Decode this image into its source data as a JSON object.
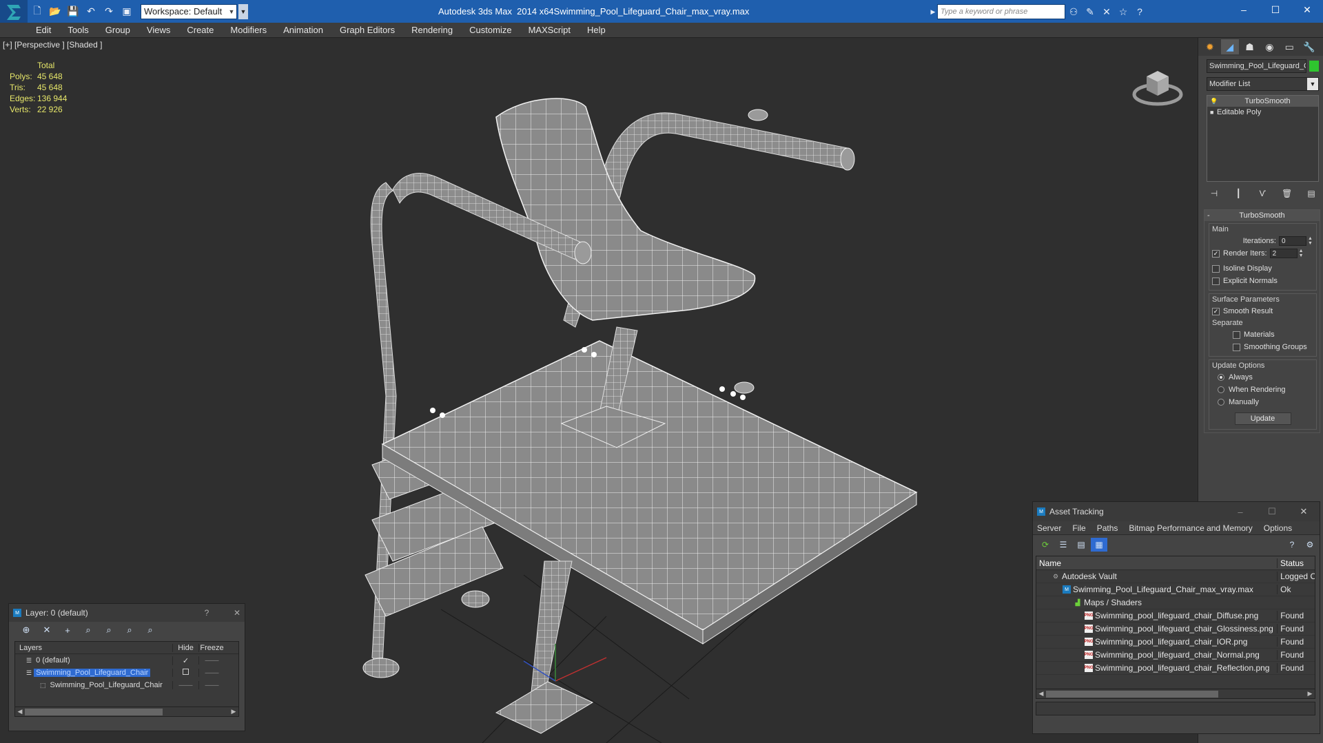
{
  "titlebar": {
    "app_title": "Autodesk 3ds Max  2014 x64",
    "file_title": "Swimming_Pool_Lifeguard_Chair_max_vray.max",
    "workspace_label": "Workspace: Default",
    "search_placeholder": "Type a keyword or phrase",
    "minimize": "–",
    "maximize": "☐",
    "close": "✕"
  },
  "menu": [
    "Edit",
    "Tools",
    "Group",
    "Views",
    "Create",
    "Modifiers",
    "Animation",
    "Graph Editors",
    "Rendering",
    "Customize",
    "MAXScript",
    "Help"
  ],
  "viewport": {
    "label": "[+] [Perspective ] [Shaded ]",
    "stats": {
      "header": "Total",
      "polys_label": "Polys:",
      "polys": "45 648",
      "tris_label": "Tris:",
      "tris": "45 648",
      "edges_label": "Edges:",
      "edges": "136 944",
      "verts_label": "Verts:",
      "verts": "22 926"
    }
  },
  "command_panel": {
    "object_name": "Swimming_Pool_Lifeguard_Ch",
    "object_color": "#2fc52f",
    "modifier_list": "Modifier List",
    "stack": [
      "TurboSmooth",
      "Editable Poly"
    ],
    "rollout_title": "TurboSmooth",
    "main_group": "Main",
    "iterations_label": "Iterations:",
    "iterations": "0",
    "render_iters_label": "Render Iters:",
    "render_iters": "2",
    "isoline_label": "Isoline Display",
    "explicit_normals_label": "Explicit Normals",
    "surface_group": "Surface Parameters",
    "smooth_result_label": "Smooth Result",
    "separate_label": "Separate",
    "materials_label": "Materials",
    "smoothing_groups_label": "Smoothing Groups",
    "update_group": "Update Options",
    "always_label": "Always",
    "when_rendering_label": "When Rendering",
    "manually_label": "Manually",
    "update_button": "Update"
  },
  "layer_dialog": {
    "title": "Layer: 0 (default)",
    "help": "?",
    "close": "✕",
    "col_layers": "Layers",
    "col_hide": "Hide",
    "col_freeze": "Freeze",
    "rows": [
      "0 (default)",
      "Swimming_Pool_Lifeguard_Chair",
      "Swimming_Pool_Lifeguard_Chair"
    ]
  },
  "asset_dialog": {
    "title": "Asset Tracking",
    "menu": [
      "Server",
      "File",
      "Paths",
      "Bitmap Performance and Memory",
      "Options"
    ],
    "col_name": "Name",
    "col_status": "Status",
    "rows": [
      {
        "name": "Autodesk Vault",
        "status": "Logged C"
      },
      {
        "name": "Swimming_Pool_Lifeguard_Chair_max_vray.max",
        "status": "Ok"
      },
      {
        "name": "Maps / Shaders",
        "status": ""
      },
      {
        "name": "Swimming_pool_lifeguard_chair_Diffuse.png",
        "status": "Found"
      },
      {
        "name": "Swimming_pool_lifeguard_chair_Glossiness.png",
        "status": "Found"
      },
      {
        "name": "Swimming_pool_lifeguard_chair_IOR.png",
        "status": "Found"
      },
      {
        "name": "Swimming_pool_lifeguard_chair_Normal.png",
        "status": "Found"
      },
      {
        "name": "Swimming_pool_lifeguard_chair_Reflection.png",
        "status": "Found"
      }
    ]
  },
  "icons": {
    "png_badge": "PNG",
    "check": "✓"
  }
}
